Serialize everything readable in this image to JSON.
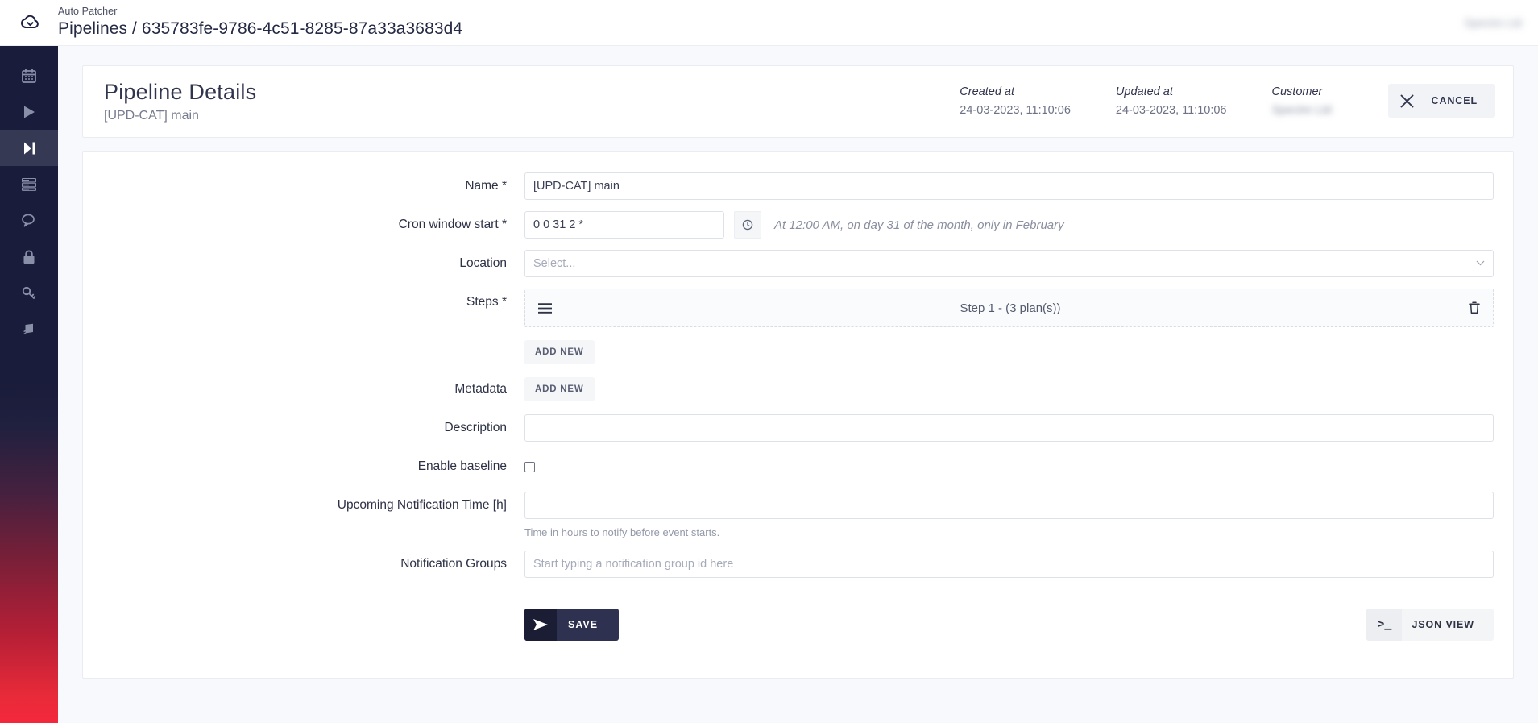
{
  "topbar": {
    "app_name": "Auto Patcher",
    "breadcrumb": "Pipelines / 635783fe-9786-4c51-8285-87a33a3683d4",
    "user_name": "Spectre Ltd"
  },
  "sidebar": {
    "items": [
      {
        "icon": "calendar-icon",
        "active": false
      },
      {
        "icon": "play-icon",
        "active": false
      },
      {
        "icon": "pipeline-icon",
        "active": true
      },
      {
        "icon": "server-icon",
        "active": false
      },
      {
        "icon": "chat-icon",
        "active": false
      },
      {
        "icon": "lock-icon",
        "active": false
      },
      {
        "icon": "key-icon",
        "active": false
      },
      {
        "icon": "book-icon",
        "active": false
      }
    ]
  },
  "header": {
    "title": "Pipeline Details",
    "subtitle": "[UPD-CAT] main",
    "created_label": "Created at",
    "created_value": "24-03-2023, 11:10:06",
    "updated_label": "Updated at",
    "updated_value": "24-03-2023, 11:10:06",
    "customer_label": "Customer",
    "customer_value": "Spectre Ltd",
    "cancel_label": "CANCEL"
  },
  "form": {
    "name": {
      "label": "Name *",
      "value": "[UPD-CAT] main"
    },
    "cron": {
      "label": "Cron window start *",
      "value": "0 0 31 2 *",
      "description": "At 12:00 AM, on day 31 of the month, only in February"
    },
    "location": {
      "label": "Location",
      "placeholder": "Select..."
    },
    "steps": {
      "label": "Steps *",
      "rows": [
        {
          "title": "Step 1 - (3 plan(s))"
        }
      ],
      "add_label": "ADD NEW"
    },
    "metadata": {
      "label": "Metadata",
      "add_label": "ADD NEW"
    },
    "description": {
      "label": "Description",
      "value": ""
    },
    "enable_baseline": {
      "label": "Enable baseline",
      "checked": false
    },
    "notification_time": {
      "label": "Upcoming Notification Time [h]",
      "value": "",
      "helper": "Time in hours to notify before event starts."
    },
    "notification_groups": {
      "label": "Notification Groups",
      "placeholder": "Start typing a notification group id here"
    }
  },
  "footer": {
    "save_label": "SAVE",
    "json_view_label": "JSON VIEW",
    "json_icon_text": ">_"
  }
}
